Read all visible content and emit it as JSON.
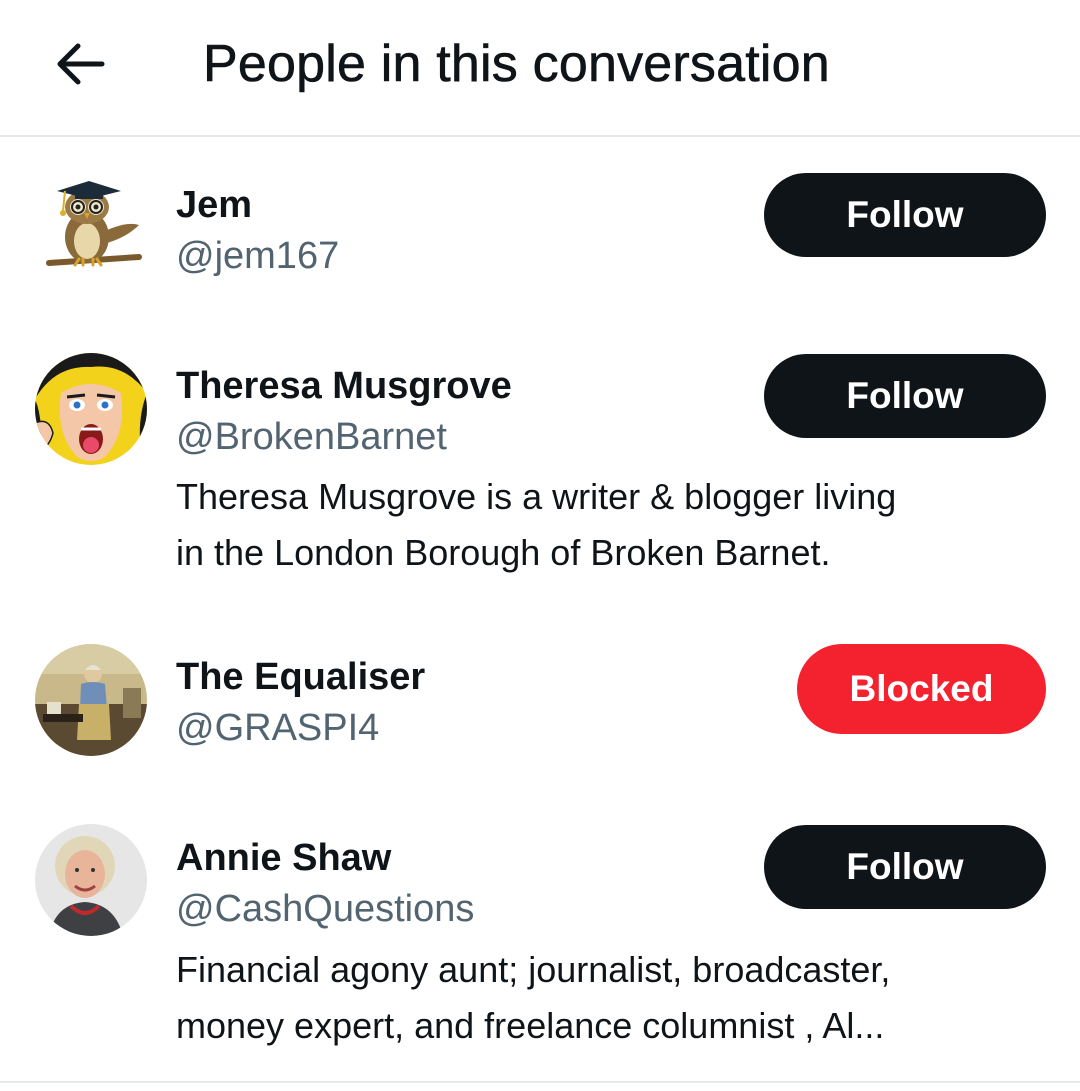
{
  "header": {
    "back_icon": "arrow-left-icon",
    "title": "People in this conversation"
  },
  "users": [
    {
      "name": "Jem",
      "handle": "@jem167",
      "bio": [],
      "button": "Follow",
      "avatar": "owl-graduate-avatar"
    },
    {
      "name": "Theresa Musgrove",
      "handle": "@BrokenBarnet",
      "bio": [
        "Theresa Musgrove is a writer & blogger living",
        "in the London Borough of Broken Barnet."
      ],
      "button": "Follow",
      "avatar": "comic-screaming-woman-avatar"
    },
    {
      "name": "The Equaliser",
      "handle": "@GRASPI4",
      "bio": [],
      "button": "Blocked",
      "avatar": "painting-figure-avatar"
    },
    {
      "name": "Annie Shaw",
      "handle": "@CashQuestions",
      "bio": [
        "Financial agony aunt; journalist, broadcaster,",
        "money expert,  and  freelance columnist , Al..."
      ],
      "button": "Follow",
      "avatar": "woman-portrait-avatar"
    }
  ],
  "colors": {
    "follow_bg": "#0f1419",
    "blocked_bg": "#f4212e",
    "handle": "#536471",
    "divider": "#e6e9eb"
  }
}
